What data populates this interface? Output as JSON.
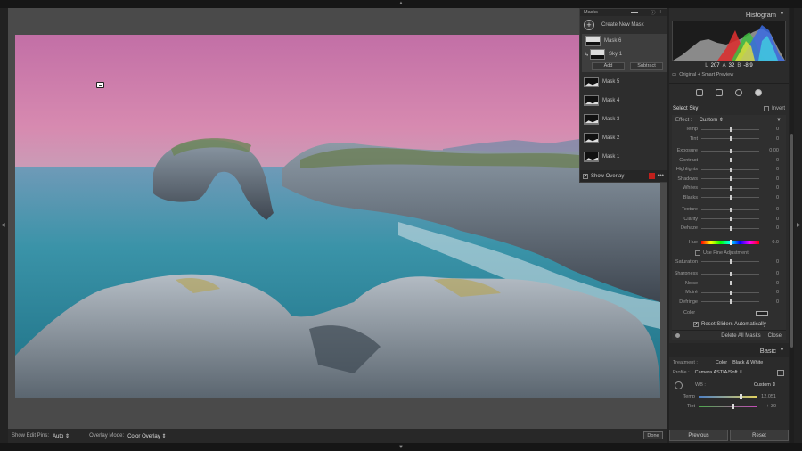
{
  "masks_panel": {
    "title": "Masks",
    "create_label": "Create New Mask",
    "mask6": "Mask 6",
    "sky1": "Sky 1",
    "add": "Add",
    "subtract": "Subtract",
    "other_masks": [
      "Mask 5",
      "Mask 4",
      "Mask 3",
      "Mask 2",
      "Mask 1"
    ],
    "show_overlay": "Show Overlay"
  },
  "toolbar": {
    "edit_pins_label": "Show Edit Pins:",
    "edit_pins_value": "Auto",
    "overlay_mode_label": "Overlay Mode:",
    "overlay_mode_value": "Color Overlay",
    "done": "Done"
  },
  "histogram": {
    "title": "Histogram",
    "L": "207",
    "A": "32",
    "B": "-8.9",
    "preview": "Original + Smart Preview"
  },
  "mask_settings": {
    "select_label": "Select Sky",
    "invert": "Invert",
    "effect_label": "Effect :",
    "effect_value": "Custom",
    "sliders_a": [
      {
        "label": "Temp",
        "value": "0"
      },
      {
        "label": "Tint",
        "value": "0"
      }
    ],
    "sliders_b": [
      {
        "label": "Exposure",
        "value": "0.00"
      },
      {
        "label": "Contrast",
        "value": "0"
      },
      {
        "label": "Highlights",
        "value": "0"
      },
      {
        "label": "Shadows",
        "value": "0"
      },
      {
        "label": "Whites",
        "value": "0"
      },
      {
        "label": "Blacks",
        "value": "0"
      }
    ],
    "sliders_c": [
      {
        "label": "Texture",
        "value": "0"
      },
      {
        "label": "Clarity",
        "value": "0"
      },
      {
        "label": "Dehaze",
        "value": "0"
      }
    ],
    "hue_label": "Hue",
    "hue_value": "0.0",
    "fine_adjust": "Use Fine Adjustment",
    "sliders_d": [
      {
        "label": "Saturation",
        "value": "0"
      }
    ],
    "sliders_e": [
      {
        "label": "Sharpness",
        "value": "0"
      },
      {
        "label": "Noise",
        "value": "0"
      },
      {
        "label": "Moiré",
        "value": "0"
      },
      {
        "label": "Defringe",
        "value": "0"
      }
    ],
    "color_label": "Color",
    "reset_auto": "Reset Sliders Automatically",
    "delete_all": "Delete All Masks",
    "close": "Close"
  },
  "basic": {
    "title": "Basic",
    "treatment_label": "Treatment :",
    "color": "Color",
    "bw": "Black & White",
    "profile_label": "Profile :",
    "profile_value": "Camera ASTIA/Soft",
    "wb_label": "WB :",
    "wb_value": "Custom",
    "temp_label": "Temp",
    "temp_value": "12,051",
    "tint_label": "Tint",
    "tint_value": "+ 30"
  },
  "buttons": {
    "previous": "Previous",
    "reset": "Reset"
  }
}
